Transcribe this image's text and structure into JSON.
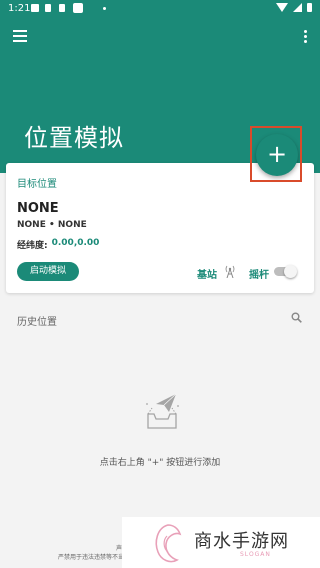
{
  "status_bar": {
    "time": "1:21"
  },
  "header": {
    "title": "位置模拟"
  },
  "fab": {
    "label": "+"
  },
  "card": {
    "target_label": "目标位置",
    "location_name": "NONE",
    "location_sub": "NONE • NONE",
    "coords_label": "经纬度:",
    "coords_value": "0.00,0.00",
    "start_button": "启动模拟",
    "station_label": "基站",
    "joystick_label": "摇杆",
    "joystick_on": false
  },
  "history": {
    "title": "历史位置",
    "empty_hint": "点击右上角 \"+\" 按钮进行添加"
  },
  "disclaimer": {
    "line1": "声明:",
    "line2": "严禁用于违法违禁等不当行"
  },
  "watermark": {
    "text": "商水手游网",
    "slogan": "SLOGAN"
  },
  "colors": {
    "primary": "#1b8a78",
    "highlight": "#d94b2b",
    "background": "#f3f3f3"
  },
  "icons": [
    "menu-icon",
    "more-vert-icon",
    "add-icon",
    "antenna-icon",
    "search-icon",
    "empty-inbox-icon",
    "paper-plane-icon"
  ]
}
